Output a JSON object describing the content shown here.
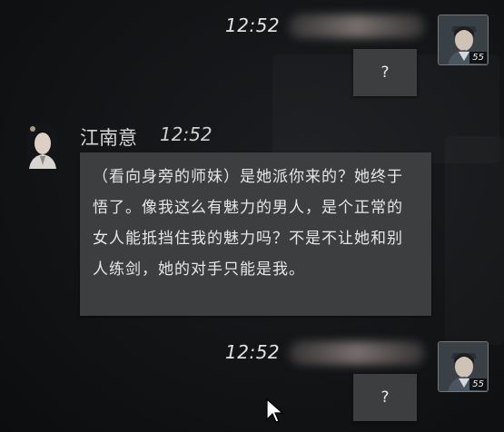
{
  "messages": [
    {
      "time": "12:52",
      "text": "?",
      "level": "55"
    },
    {
      "name": "江南意",
      "time": "12:52",
      "text": "（看向身旁的师妹）是她派你来的？她终于悟了。像我这么有魅力的男人，是个正常的女人能抵挡住我的魅力吗？不是不让她和别人练剑，她的对手只能是我。"
    },
    {
      "time": "12:52",
      "text": "?",
      "level": "55"
    }
  ],
  "icons": {
    "self_avatar": "player-portrait-icon",
    "npc_avatar": "npc-portrait-icon",
    "cursor": "mouse-cursor-icon"
  }
}
